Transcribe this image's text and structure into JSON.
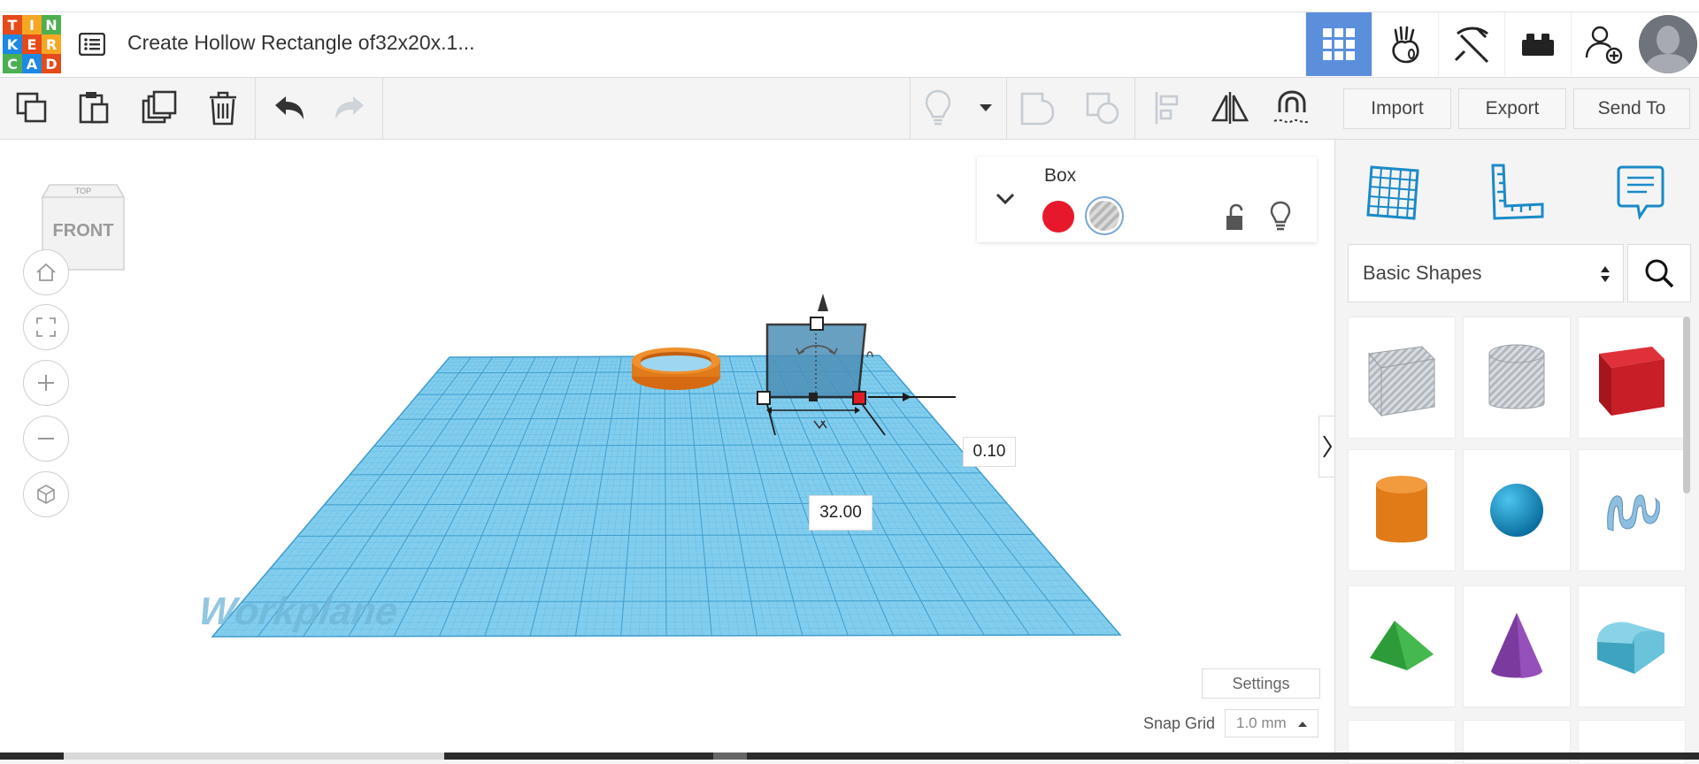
{
  "app": {
    "logo_letters": [
      "T",
      "I",
      "N",
      "K",
      "E",
      "R",
      "C",
      "A",
      "D"
    ],
    "logo_colors": [
      "#e64a19",
      "#f5a623",
      "#4caf50",
      "#1e88e5",
      "#e64a19",
      "#f5a623",
      "#4caf50",
      "#1e88e5",
      "#e64a19"
    ],
    "title": "Create Hollow Rectangle of32x20x.1..."
  },
  "toolbar": {
    "actions": {
      "import": "Import",
      "export": "Export",
      "send_to": "Send To"
    }
  },
  "viewcube": {
    "top_label": "TOP",
    "front_label": "FRONT"
  },
  "workplane": {
    "label": "Workplane",
    "dimension_width": "32.00",
    "dimension_height": "0.10"
  },
  "shape_panel": {
    "name": "Box",
    "solid_color": "#e8182c"
  },
  "footer": {
    "settings": "Settings",
    "snap_grid_label": "Snap Grid",
    "snap_grid_value": "1.0 mm"
  },
  "sidebar": {
    "category": "Basic Shapes"
  },
  "colors": {
    "accent": "#5b8fdc",
    "workplane": "#78c8ec",
    "tinkercad_blue": "#1a8ac7"
  }
}
